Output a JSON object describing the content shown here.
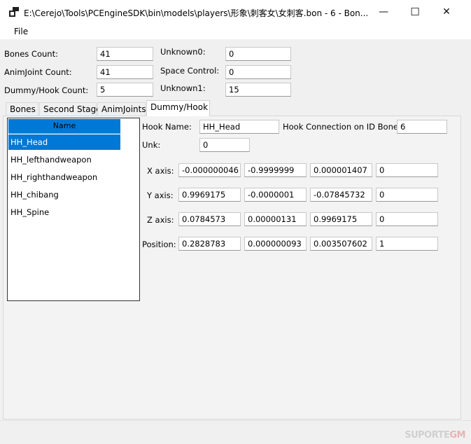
{
  "window": {
    "title": "E:\\Cerejo\\Tools\\PCEngineSDK\\bin\\models\\players\\形象\\刺客女\\女刺客.bon   -   6   -    Bon...",
    "minimize_glyph": "—",
    "maximize_glyph": "☐",
    "close_glyph": "✕"
  },
  "menu": {
    "file": "File"
  },
  "header_fields": {
    "bones_count": {
      "label": "Bones Count:",
      "value": "41"
    },
    "animjoint_count": {
      "label": "AnimJoint Count:",
      "value": "41"
    },
    "dummy_hook_count": {
      "label": "Dummy/Hook Count:",
      "value": "5"
    },
    "unknown0": {
      "label": "Unknown0:",
      "value": "0"
    },
    "space_control": {
      "label": "Space Control:",
      "value": "0"
    },
    "unknown1": {
      "label": "Unknown1:",
      "value": "15"
    }
  },
  "tabs": [
    {
      "label": "Bones"
    },
    {
      "label": "Second Stage"
    },
    {
      "label": "AnimJoints"
    },
    {
      "label": "Dummy/Hook"
    }
  ],
  "hook_list": {
    "header": "Name",
    "items": [
      "HH_Head",
      "HH_lefthandweapon",
      "HH_righthandweapon",
      "HH_chibang",
      "HH_Spine"
    ],
    "selected_index": 0
  },
  "hook_detail": {
    "hook_name_label": "Hook Name:",
    "hook_name_value": "HH_Head",
    "hook_conn_label": "Hook Connection on ID Bone:",
    "hook_conn_value": "6",
    "unk_label": "Unk:",
    "unk_value": "0",
    "matrix": [
      {
        "label": "X axis:",
        "values": [
          "-0.000000046",
          "-0.9999999",
          "0.000001407",
          "0"
        ]
      },
      {
        "label": "Y axis:",
        "values": [
          "0.9969175",
          "-0.0000001",
          "-0.07845732",
          "0"
        ]
      },
      {
        "label": "Z axis:",
        "values": [
          "0.0784573",
          "0.00000131",
          "0.9969175",
          "0"
        ]
      },
      {
        "label": "Position:",
        "values": [
          "0.2828783",
          "0.000000093",
          "0.003507602",
          "1"
        ]
      }
    ]
  },
  "watermark": {
    "part1": "SUPORTE",
    "part2": "GM"
  }
}
